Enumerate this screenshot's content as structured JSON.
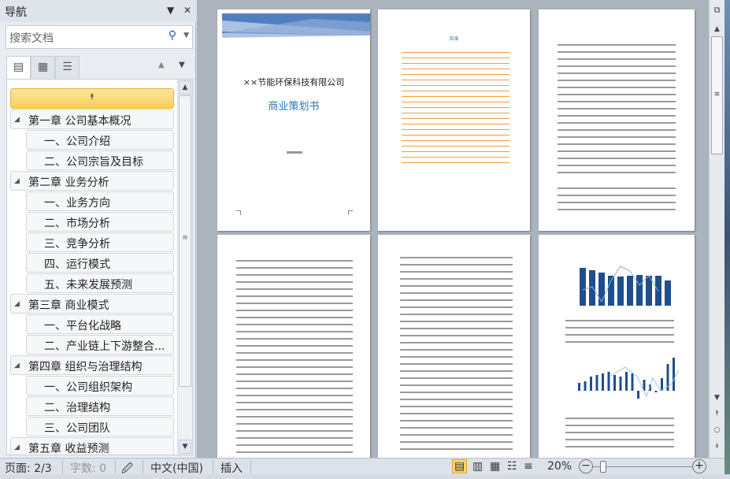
{
  "nav": {
    "title": "导航",
    "search_placeholder": "搜索文档",
    "items": [
      {
        "label": "第一章  公司基本概况",
        "level": 1
      },
      {
        "label": "一、公司介绍",
        "level": 2
      },
      {
        "label": "二、公司宗旨及目标",
        "level": 2
      },
      {
        "label": "第二章 业务分析",
        "level": 1
      },
      {
        "label": "一、业务方向",
        "level": 2
      },
      {
        "label": "二、市场分析",
        "level": 2
      },
      {
        "label": "三、竞争分析",
        "level": 2
      },
      {
        "label": "四、运行模式",
        "level": 2
      },
      {
        "label": "五、未来发展预测",
        "level": 2
      },
      {
        "label": "第三章 商业模式",
        "level": 1
      },
      {
        "label": "一、平台化战略",
        "level": 2
      },
      {
        "label": "二、产业链上下游整合...",
        "level": 2
      },
      {
        "label": "第四章 组织与治理结构",
        "level": 1
      },
      {
        "label": "一、公司组织架构",
        "level": 2
      },
      {
        "label": "二、治理结构",
        "level": 2
      },
      {
        "label": "三、公司团队",
        "level": 2
      },
      {
        "label": "第五章 收益预测",
        "level": 1
      }
    ]
  },
  "document": {
    "cover_company": "××节能环保科技有限公司",
    "cover_title": "商业策划书",
    "toc_heading": "目录"
  },
  "status": {
    "page": "页面: 2/3",
    "words": "字数: 0",
    "language": "中文(中国)",
    "mode": "插入",
    "zoom": "20%"
  },
  "colors": {
    "accent": "#f8cf5c",
    "title_blue": "#2e75b6",
    "bar": "#1f4e8c"
  }
}
